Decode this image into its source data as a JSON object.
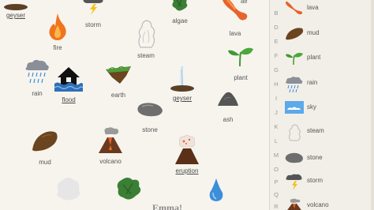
{
  "board": {
    "elements": {
      "geyser_top": "geyser",
      "storm": "storm",
      "algae": "algae",
      "lava": "lava",
      "air": "air",
      "fire": "fire",
      "steam": "steam",
      "plant": "plant",
      "rain": "rain",
      "flood": "flood",
      "earth": "earth",
      "geyser_mid": "geyser",
      "stone": "stone",
      "ash": "ash",
      "mud": "mud",
      "volcano": "volcano",
      "eruption": "eruption"
    },
    "partial_text": "Emma!"
  },
  "sidebar": {
    "letters": [
      "B",
      "D",
      "E",
      "F",
      "G",
      "H",
      "I",
      "J",
      "K",
      "L",
      "M",
      "O",
      "P",
      "Q",
      "R"
    ],
    "items": [
      "lava",
      "mud",
      "plant",
      "rain",
      "sky",
      "steam",
      "stone",
      "storm",
      "volcano"
    ]
  },
  "colors": {
    "background": "#f7f4ee",
    "sidebar": "#f2efe8",
    "fire": "#f2731d",
    "water": "#3b8fd9",
    "lava": "#e8622c",
    "plant": "#3f9a33",
    "mud": "#6b4420",
    "stone": "#6e6e6e"
  }
}
